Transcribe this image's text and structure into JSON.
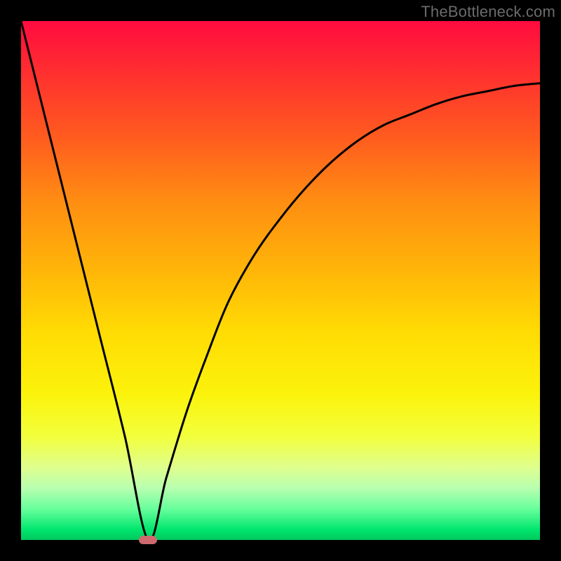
{
  "watermark": "TheBottleneck.com",
  "chart_data": {
    "type": "line",
    "title": "",
    "xlabel": "",
    "ylabel": "",
    "xlim": [
      0,
      1
    ],
    "ylim": [
      0,
      1
    ],
    "series": [
      {
        "name": "curve",
        "x": [
          0.0,
          0.05,
          0.1,
          0.15,
          0.2,
          0.245,
          0.28,
          0.32,
          0.36,
          0.4,
          0.45,
          0.5,
          0.55,
          0.6,
          0.65,
          0.7,
          0.75,
          0.8,
          0.85,
          0.9,
          0.95,
          1.0
        ],
        "values": [
          1.0,
          0.8,
          0.6,
          0.4,
          0.2,
          0.0,
          0.12,
          0.25,
          0.36,
          0.46,
          0.55,
          0.62,
          0.68,
          0.73,
          0.77,
          0.8,
          0.82,
          0.84,
          0.855,
          0.865,
          0.875,
          0.88
        ]
      }
    ],
    "marker": {
      "x": 0.245,
      "y": 0.0
    },
    "colors": {
      "curve": "#000000",
      "marker": "#cd6a6f"
    }
  }
}
